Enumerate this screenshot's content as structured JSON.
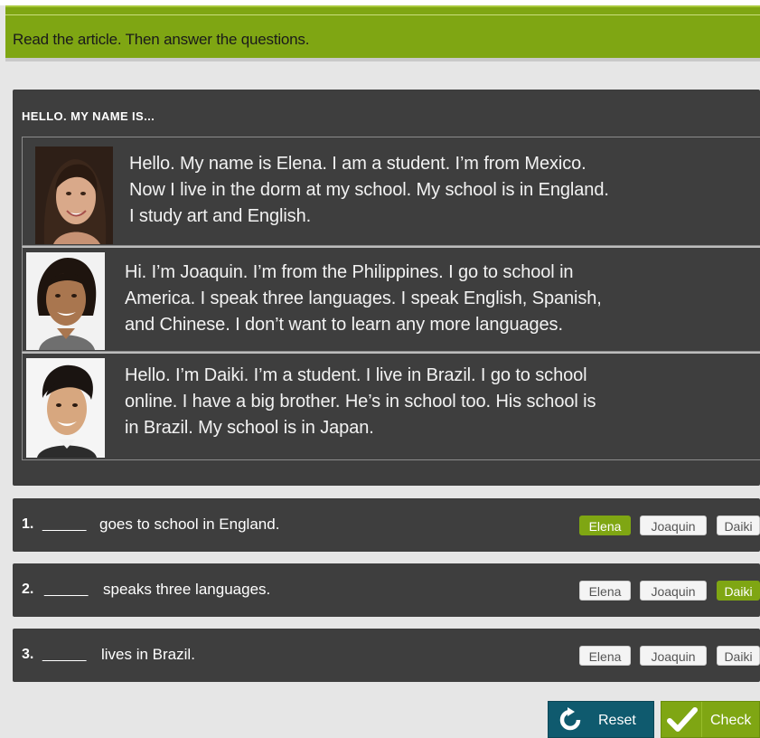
{
  "header": {
    "instruction": "Read the article. Then answer the questions."
  },
  "article": {
    "title": "HELLO. MY NAME IS...",
    "entries": [
      {
        "person": "Elena",
        "lines": [
          "Hello. My name is Elena. I am a student. I’m from Mexico.",
          "Now I live in the dorm at my school. My school is in England.",
          "I study art and English."
        ]
      },
      {
        "person": "Joaquin",
        "lines": [
          "Hi. I’m Joaquin. I’m from the Philippines. I go to school in",
          "America. I speak three languages. I speak English, Spanish,",
          "and Chinese. I don’t want to learn any more languages."
        ]
      },
      {
        "person": "Daiki",
        "lines": [
          "Hello. I’m Daiki. I’m a student. I live in Brazil. I go to school",
          "online. I have a big brother. He’s in school too. His school is",
          "in Brazil. My school is in Japan."
        ]
      }
    ]
  },
  "questions": [
    {
      "number": "1.",
      "blank": "______",
      "text": "goes to school in England.",
      "options": [
        "Elena",
        "Joaquin",
        "Daiki"
      ],
      "selected": "Elena"
    },
    {
      "number": "2.",
      "blank": "______",
      "text": "speaks three languages.",
      "options": [
        "Elena",
        "Joaquin",
        "Daiki"
      ],
      "selected": "Daiki"
    },
    {
      "number": "3.",
      "blank": "______",
      "text": "lives in Brazil.",
      "options": [
        "Elena",
        "Joaquin",
        "Daiki"
      ],
      "selected": ""
    }
  ],
  "buttons": {
    "reset_label": "Reset",
    "check_label": "Check"
  },
  "colors": {
    "accent_green": "#7fa613",
    "panel_dark": "#3e3e3e",
    "reset_blue": "#0f5a6e",
    "background": "#e6e6e6"
  },
  "icons": {
    "reset": "refresh-icon",
    "check": "checkmark-icon"
  }
}
